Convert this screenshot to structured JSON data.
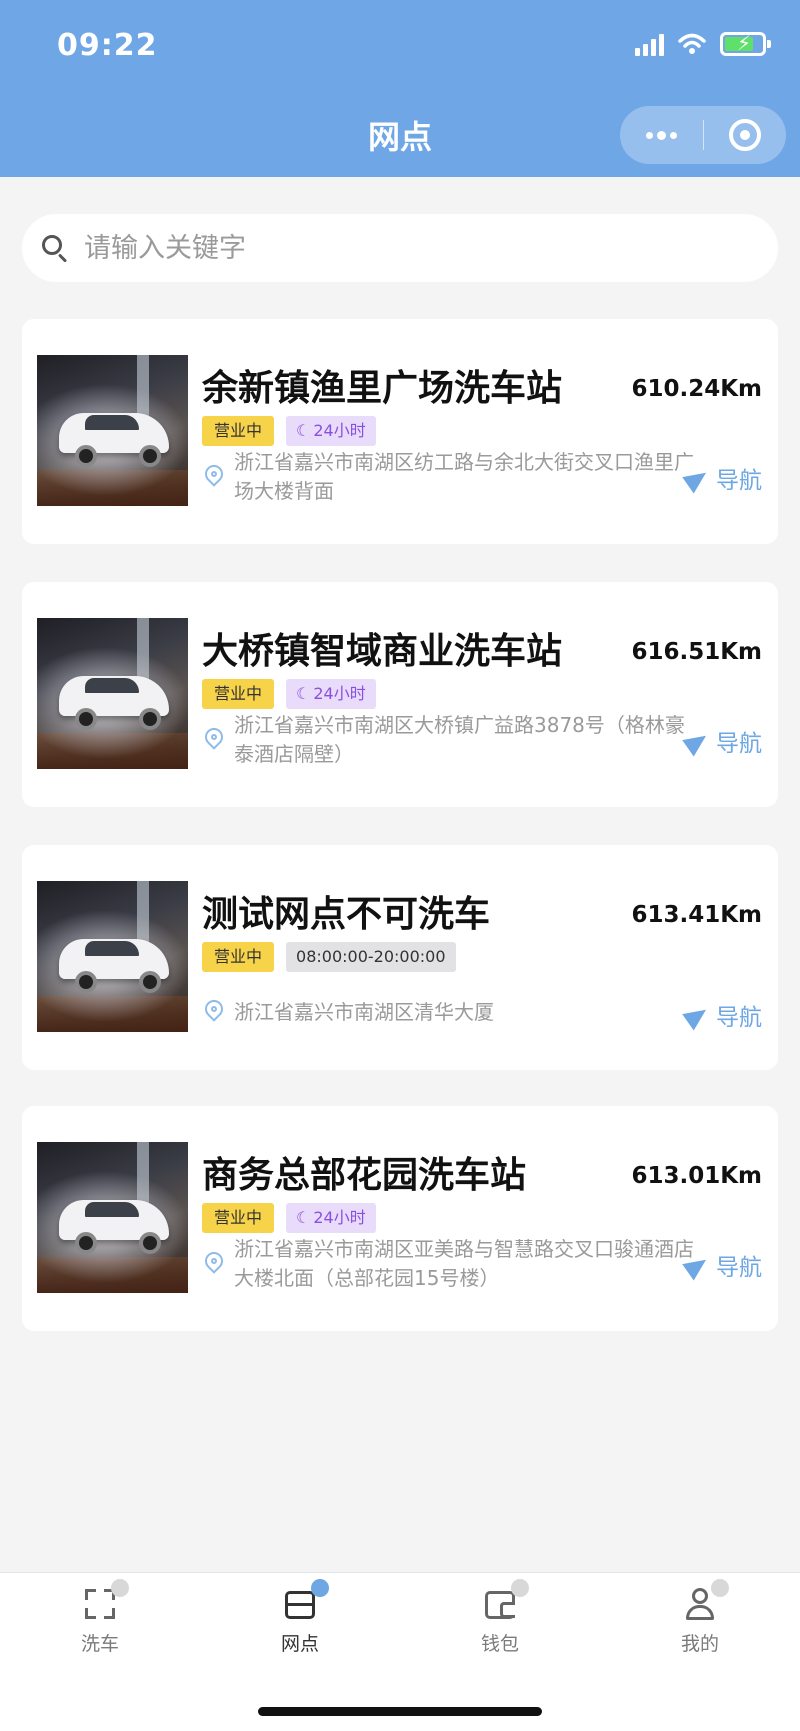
{
  "status_bar": {
    "time": "09:22"
  },
  "header": {
    "title": "网点"
  },
  "search": {
    "placeholder": "请输入关键字"
  },
  "stations": [
    {
      "name": "余新镇渔里广场洗车站",
      "distance": "610.24Km",
      "status": "营业中",
      "hours": "24小时",
      "hours_type": "24h",
      "address": "浙江省嘉兴市南湖区纺工路与余北大街交叉口渔里广场大楼背面",
      "nav_label": "导航"
    },
    {
      "name": "大桥镇智域商业洗车站",
      "distance": "616.51Km",
      "status": "营业中",
      "hours": "24小时",
      "hours_type": "24h",
      "address": "浙江省嘉兴市南湖区大桥镇广益路3878号（格林豪泰酒店隔壁）",
      "nav_label": "导航"
    },
    {
      "name": "测试网点不可洗车",
      "distance": "613.41Km",
      "status": "营业中",
      "hours": "08:00:00-20:00:00",
      "hours_type": "range",
      "address": "浙江省嘉兴市南湖区清华大厦",
      "nav_label": "导航"
    },
    {
      "name": "商务总部花园洗车站",
      "distance": "613.01Km",
      "status": "营业中",
      "hours": "24小时",
      "hours_type": "24h",
      "address": "浙江省嘉兴市南湖区亚美路与智慧路交叉口骏通酒店大楼北面（总部花园15号楼）",
      "nav_label": "导航"
    }
  ],
  "tabbar": {
    "items": [
      {
        "label": "洗车",
        "icon": "scan-icon",
        "active": false
      },
      {
        "label": "网点",
        "icon": "store-icon",
        "active": true
      },
      {
        "label": "钱包",
        "icon": "wallet-icon",
        "active": false
      },
      {
        "label": "我的",
        "icon": "user-icon",
        "active": false
      }
    ]
  },
  "colors": {
    "header_bg": "#6fa7e6",
    "open_tag": "#f7d34a",
    "hours_tag": "#e9dcfb",
    "nav_text": "#6ea7e3"
  }
}
